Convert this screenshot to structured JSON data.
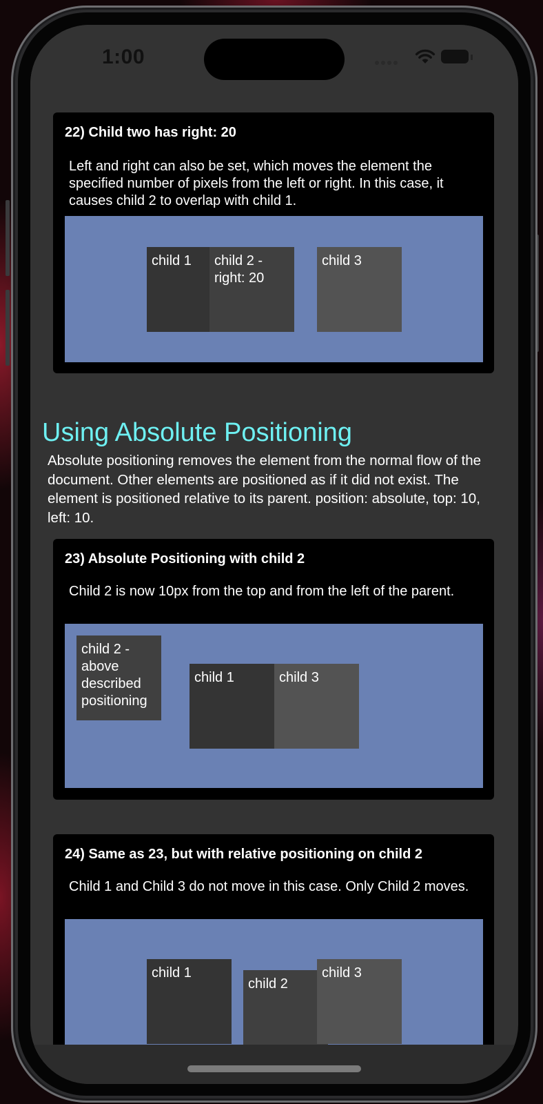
{
  "status_bar": {
    "time": "1:00"
  },
  "card22": {
    "title": "22) Child two has right: 20",
    "description": "Left and right can also be set, which moves the element the specified number of pixels from the left or right. In this case, it causes child 2 to overlap with child 1.",
    "child1": "child 1",
    "child2": "child 2 - right: 20",
    "child3": "child 3"
  },
  "section": {
    "heading": "Using Absolute Positioning",
    "body": "Absolute positioning removes the element from the normal flow of the document. Other elements are positioned as if it did not exist. The element is positioned relative to its parent. position: absolute, top: 10, left: 10."
  },
  "card23": {
    "title": "23) Absolute Positioning with child 2",
    "description": "Child 2 is now 10px from the top and from the left of the parent.",
    "child1": "child 1",
    "child2": "child 2 - above described positioning",
    "child3": "child 3"
  },
  "card24": {
    "title": "24) Same as 23, but with relative positioning on child 2",
    "description": "Child 1 and Child 3 do not move in this case. Only Child 2 moves.",
    "child1": "child 1",
    "child2": "child 2",
    "child3": "child 3"
  },
  "colors": {
    "heading_accent": "#6ef0f2",
    "stage_blue": "#6a81b4",
    "page_bg": "#333333",
    "card_bg": "#000000"
  },
  "icons": [
    "wifi-icon",
    "battery-icon",
    "cellular-signal-icon"
  ]
}
